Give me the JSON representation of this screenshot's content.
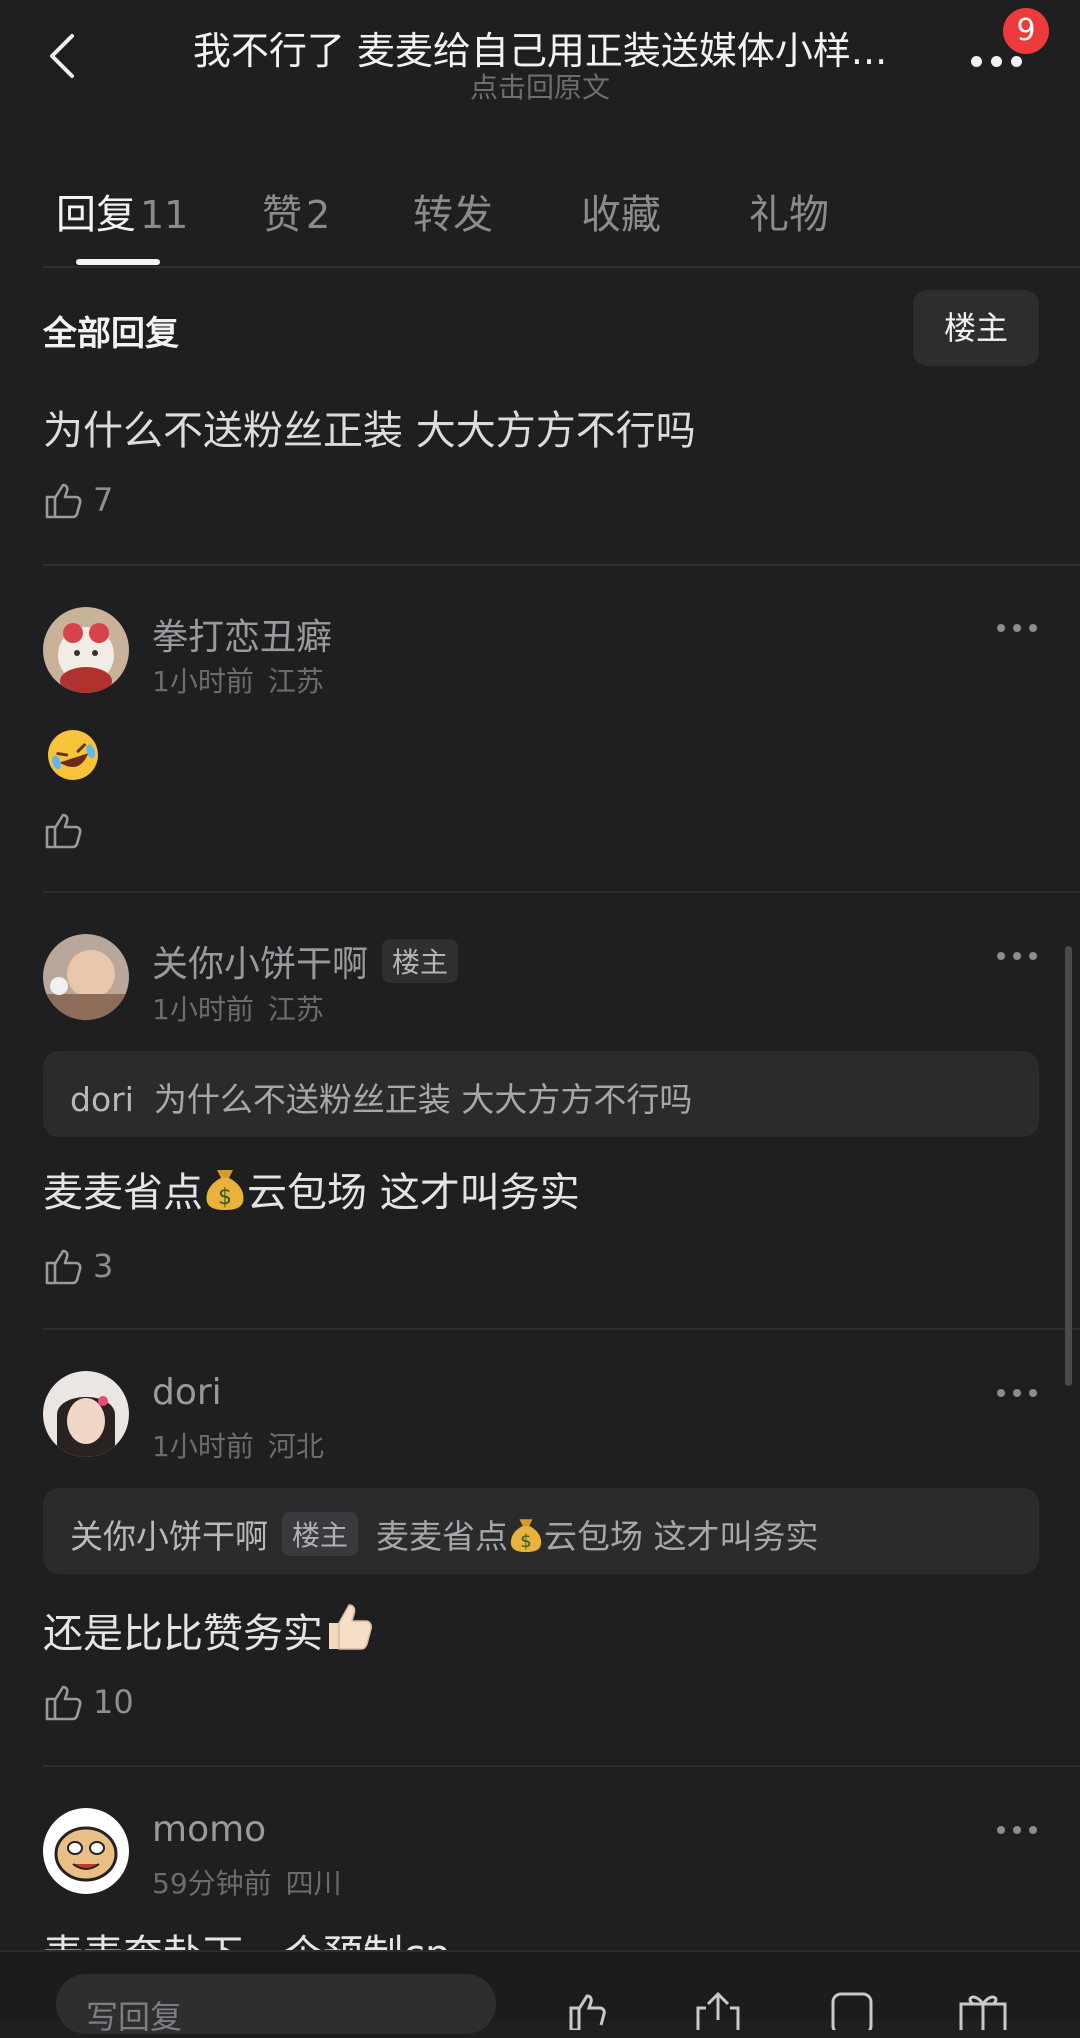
{
  "header": {
    "title": "我不行了 麦麦给自己用正装送媒体小样...",
    "subtitle": "点击回原文",
    "notification_count": "9"
  },
  "tabs": [
    {
      "label": "回复",
      "count": "11"
    },
    {
      "label": "赞",
      "count": "2"
    },
    {
      "label": "转发",
      "count": ""
    },
    {
      "label": "收藏",
      "count": ""
    },
    {
      "label": "礼物",
      "count": ""
    }
  ],
  "section_title": "全部回复",
  "filter_label": "楼主",
  "top_comment": {
    "text": "为什么不送粉丝正装 大大方方不行吗",
    "likes": "7"
  },
  "comments": [
    {
      "name": "拳打恋丑癖",
      "tag": "",
      "time": "1小时前",
      "location": "江苏",
      "quote": null,
      "likes": ""
    },
    {
      "name": "关你小饼干啊",
      "tag": "楼主",
      "time": "1小时前",
      "location": "江苏",
      "quote": {
        "name": "dori",
        "tag": "",
        "text": "为什么不送粉丝正装 大大方方不行吗"
      },
      "body_pre": "麦麦省点",
      "body_post": "云包场 这才叫务实",
      "likes": "3"
    },
    {
      "name": "dori",
      "tag": "",
      "time": "1小时前",
      "location": "河北",
      "quote": {
        "name": "关你小饼干啊",
        "tag": "楼主",
        "text_pre": "麦麦省点",
        "text_post": "云包场 这才叫务实"
      },
      "body": "还是比比赞务实",
      "likes": "10"
    },
    {
      "name": "momo",
      "tag": "",
      "time": "59分钟前",
      "location": "四川",
      "body_partial": "麦麦奔赴下一个预制cp",
      "likes": ""
    }
  ],
  "bottom_bar": {
    "input_placeholder": "写回复"
  },
  "icons": [
    "back-icon",
    "more-icon",
    "like-icon",
    "laughing-emoji-icon",
    "money-bag-emoji-icon",
    "thumbs-up-emoji-icon",
    "share-icon",
    "comment-icon",
    "gift-icon"
  ],
  "colors": {
    "background": "#1f1f21",
    "badge": "#ee3a3a",
    "text": "#e6e6e8",
    "muted": "#6c6c70"
  }
}
